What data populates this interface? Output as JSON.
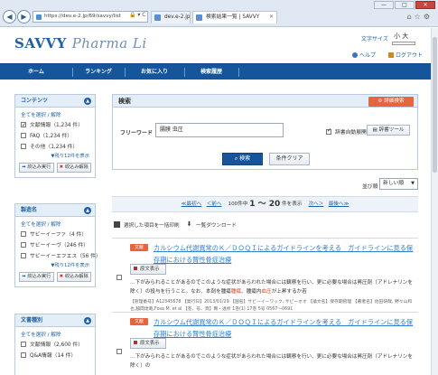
{
  "browser": {
    "url": "https://dev.e-2.jp/69/savvy/list",
    "tab_inactive": "dev.e-2.jp",
    "tab_active": "検索結果一覧 | SAVVY",
    "url_suffix": "🔒 ▾ C"
  },
  "header": {
    "logo_main": "SAVVY",
    "logo_sub": "Pharma Li",
    "fontsize_label": "文字サイズ",
    "fontsize_options": "小 大",
    "help": "ヘルプ",
    "logout": "ログアウト"
  },
  "nav": [
    "ホーム",
    "ランキング",
    "お気に入り",
    "検索履歴"
  ],
  "sidebar": {
    "contents": {
      "title": "コンテンツ",
      "select_all": "全てを選択 / 解除",
      "items": [
        {
          "label": "文献情報（1,234 件）",
          "checked": true
        },
        {
          "label": "FAQ（1,234 件）",
          "checked": false
        },
        {
          "label": "その他（1,234 件）",
          "checked": false
        }
      ],
      "more": "▼残り12件を表示",
      "filter_btn": "絞込み実行",
      "clear_btn": "絞込み解除"
    },
    "maker": {
      "title": "製造名",
      "select_all": "全てを選択 / 解除",
      "items": [
        {
          "label": "サビーイーファ（4 件）",
          "checked": false
        },
        {
          "label": "サビーイーヴ（246 件）",
          "checked": false
        },
        {
          "label": "サビーイーエフエス（56 件）",
          "checked": false
        }
      ],
      "more": "▼残り12件を表示",
      "filter_btn": "絞込み実行",
      "clear_btn": "絞込み解除"
    },
    "doctype": {
      "title": "文書種別",
      "select_all": "全てを選択 / 解除",
      "items": [
        {
          "label": "文献情報（2,600 件）",
          "checked": false
        },
        {
          "label": "Q&A情報（14 件）",
          "checked": false
        }
      ]
    }
  },
  "search": {
    "title": "検索",
    "advanced": "詳細検索",
    "freeword_label": "フリーワード",
    "freeword_value": "腸膜 虫圧",
    "synonym_label": "辞書自動展開",
    "dict_tool": "辞書ツール",
    "search_btn": "検索",
    "clear_btn": "条件クリア"
  },
  "sort": {
    "label": "並び順",
    "value": "新しい順"
  },
  "pager": {
    "first": "≪最初へ",
    "prev": "＜前へ",
    "count_prefix": "100件中",
    "range": "1 ～ 20",
    "count_suffix": "件を表示",
    "next": "次へ＞",
    "last": "最後へ≫"
  },
  "utility": {
    "print": "選択した項目を一括印刷",
    "download": "一覧ダウンロード"
  },
  "results": [
    {
      "badge": "文献",
      "title": "カルシウム代謝異常のＫ／ＤＯＱＩによるガイドラインを考える　ガイドラインに見る保存期における腎性骨症治療",
      "fulltext": "原文表示",
      "snippet_pre": "…下がみられることがあるのでこのような症状があらわれた場合には観察を行い、更に必要な場合は昇圧剤（アドレナリンを除く）の投与を行うこと。なお、本剤を腫瘍",
      "snippet_hl1": "腫瘍",
      "snippet_mid": "、腫瘍内",
      "snippet_hl2": "血圧",
      "snippet_post": "が上昇するか若",
      "meta": "【管理番号】A12345678 【発行日】2013/01/29 【国名】サビーイーワック, サビーオオ 【論文名】保存期管理 【著者名】佐田研哉, 野々山和也,脇間達哉,Fosa M. et al 【巻、号、頁】腎・透析 1巻(1) 17巻 5号 0567～0691"
    },
    {
      "badge": "文献",
      "title": "カルシウム代謝異常のＫ／ＤＯＱＩによるガイドラインを考える　ガイドラインに見る保存期における腎性骨症治療",
      "fulltext": "原文表示",
      "snippet_pre": "…下がみられることがあるのでこのような症状があらわれた場合には観察を行い、更に必要な場合は昇圧剤（アドレナリンを除く）の",
      "snippet_hl1": "",
      "snippet_mid": "",
      "snippet_hl2": "",
      "snippet_post": "",
      "meta": ""
    }
  ]
}
